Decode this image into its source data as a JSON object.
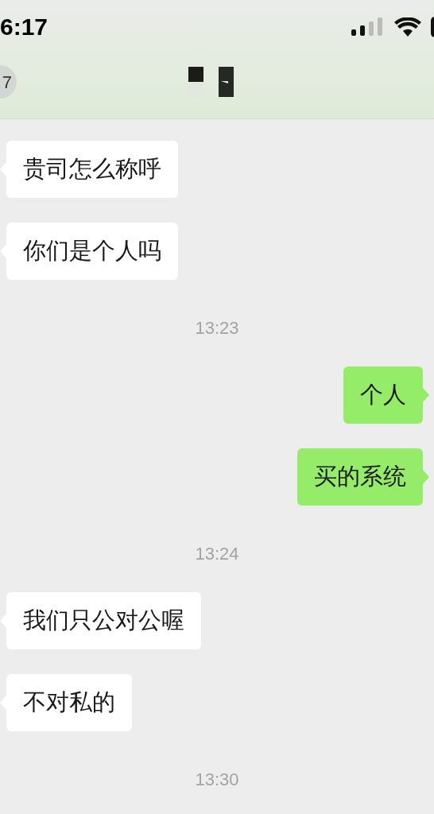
{
  "status_bar": {
    "time": "6:17"
  },
  "header": {
    "back_badge": "7"
  },
  "messages": [
    {
      "kind": "incoming",
      "text": "贵司怎么称呼"
    },
    {
      "kind": "incoming",
      "text": "你们是个人吗"
    },
    {
      "kind": "time",
      "text": "13:23"
    },
    {
      "kind": "outgoing",
      "text": "个人"
    },
    {
      "kind": "outgoing",
      "text": "买的系统"
    },
    {
      "kind": "time",
      "text": "13:24"
    },
    {
      "kind": "incoming",
      "text": "我们只公对公喔"
    },
    {
      "kind": "incoming",
      "text": "不对私的"
    },
    {
      "kind": "time",
      "text": "13:30"
    },
    {
      "kind": "cut_off"
    }
  ]
}
